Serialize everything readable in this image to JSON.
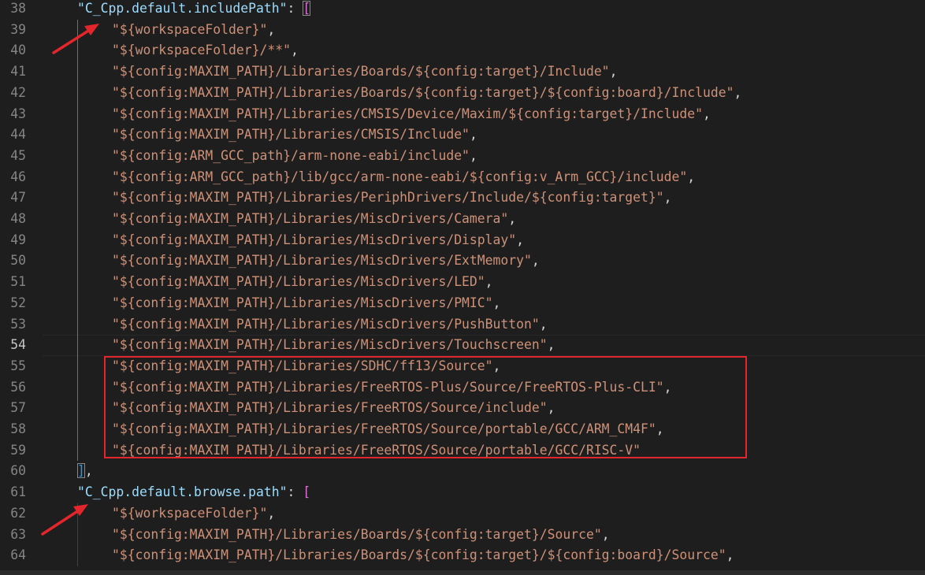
{
  "editor": {
    "first_line_number": 38,
    "active_line_number": 54,
    "lines": [
      {
        "n": "38",
        "kind": "key-open",
        "key": "\"C_Cpp.default.includePath\"",
        "after": ": ",
        "bracket": "[",
        "boxed": true
      },
      {
        "n": "39",
        "kind": "item",
        "text": "\"${workspaceFolder}\"",
        "tail": ","
      },
      {
        "n": "40",
        "kind": "item",
        "text": "\"${workspaceFolder}/**\"",
        "tail": ","
      },
      {
        "n": "41",
        "kind": "item",
        "text": "\"${config:MAXIM_PATH}/Libraries/Boards/${config:target}/Include\"",
        "tail": ","
      },
      {
        "n": "42",
        "kind": "item",
        "text": "\"${config:MAXIM_PATH}/Libraries/Boards/${config:target}/${config:board}/Include\"",
        "tail": ","
      },
      {
        "n": "43",
        "kind": "item",
        "text": "\"${config:MAXIM_PATH}/Libraries/CMSIS/Device/Maxim/${config:target}/Include\"",
        "tail": ","
      },
      {
        "n": "44",
        "kind": "item",
        "text": "\"${config:MAXIM_PATH}/Libraries/CMSIS/Include\"",
        "tail": ","
      },
      {
        "n": "45",
        "kind": "item",
        "text": "\"${config:ARM_GCC_path}/arm-none-eabi/include\"",
        "tail": ","
      },
      {
        "n": "46",
        "kind": "item",
        "text": "\"${config:ARM_GCC_path}/lib/gcc/arm-none-eabi/${config:v_Arm_GCC}/include\"",
        "tail": ","
      },
      {
        "n": "47",
        "kind": "item",
        "text": "\"${config:MAXIM_PATH}/Libraries/PeriphDrivers/Include/${config:target}\"",
        "tail": ","
      },
      {
        "n": "48",
        "kind": "item",
        "text": "\"${config:MAXIM_PATH}/Libraries/MiscDrivers/Camera\"",
        "tail": ","
      },
      {
        "n": "49",
        "kind": "item",
        "text": "\"${config:MAXIM_PATH}/Libraries/MiscDrivers/Display\"",
        "tail": ","
      },
      {
        "n": "50",
        "kind": "item",
        "text": "\"${config:MAXIM_PATH}/Libraries/MiscDrivers/ExtMemory\"",
        "tail": ","
      },
      {
        "n": "51",
        "kind": "item",
        "text": "\"${config:MAXIM_PATH}/Libraries/MiscDrivers/LED\"",
        "tail": ","
      },
      {
        "n": "52",
        "kind": "item",
        "text": "\"${config:MAXIM_PATH}/Libraries/MiscDrivers/PMIC\"",
        "tail": ","
      },
      {
        "n": "53",
        "kind": "item",
        "text": "\"${config:MAXIM_PATH}/Libraries/MiscDrivers/PushButton\"",
        "tail": ","
      },
      {
        "n": "54",
        "kind": "item",
        "text": "\"${config:MAXIM_PATH}/Libraries/MiscDrivers/Touchscreen\"",
        "tail": ","
      },
      {
        "n": "55",
        "kind": "item",
        "text": "\"${config:MAXIM_PATH}/Libraries/SDHC/ff13/Source\"",
        "tail": ","
      },
      {
        "n": "56",
        "kind": "item",
        "text": "\"${config:MAXIM_PATH}/Libraries/FreeRTOS-Plus/Source/FreeRTOS-Plus-CLI\"",
        "tail": ","
      },
      {
        "n": "57",
        "kind": "item",
        "text": "\"${config:MAXIM_PATH}/Libraries/FreeRTOS/Source/include\"",
        "tail": ","
      },
      {
        "n": "58",
        "kind": "item",
        "text": "\"${config:MAXIM_PATH}/Libraries/FreeRTOS/Source/portable/GCC/ARM_CM4F\"",
        "tail": ","
      },
      {
        "n": "59",
        "kind": "item",
        "text": "\"${config:MAXIM_PATH}/Libraries/FreeRTOS/Source/portable/GCC/RISC-V\"",
        "tail": ""
      },
      {
        "n": "60",
        "kind": "close",
        "bracket": "]",
        "tail": ",",
        "boxed": true
      },
      {
        "n": "61",
        "kind": "key-open",
        "key": "\"C_Cpp.default.browse.path\"",
        "after": ": ",
        "bracket": "[",
        "boxed": false
      },
      {
        "n": "62",
        "kind": "item",
        "text": "\"${workspaceFolder}\"",
        "tail": ","
      },
      {
        "n": "63",
        "kind": "item",
        "text": "\"${config:MAXIM_PATH}/Libraries/Boards/${config:target}/Source\"",
        "tail": ","
      },
      {
        "n": "64",
        "kind": "item",
        "text": "\"${config:MAXIM_PATH}/Libraries/Boards/${config:target}/${config:board}/Source\"",
        "tail": ","
      }
    ]
  },
  "annotations": {
    "highlight_box_color": "#e3262b",
    "arrow_color": "#e3262b",
    "arrow_icon": "red-arrow-icon",
    "boxed_lines_first": "55",
    "boxed_lines_last": "59"
  },
  "colors": {
    "background": "#1e1e1e",
    "string": "#ce9178",
    "property_key": "#9cdcfe",
    "punctuation": "#d4d4d4",
    "bracket_open": "#da70d6",
    "bracket_close": "#179fff",
    "line_number": "#858585",
    "active_line_number": "#c6c6c6"
  }
}
